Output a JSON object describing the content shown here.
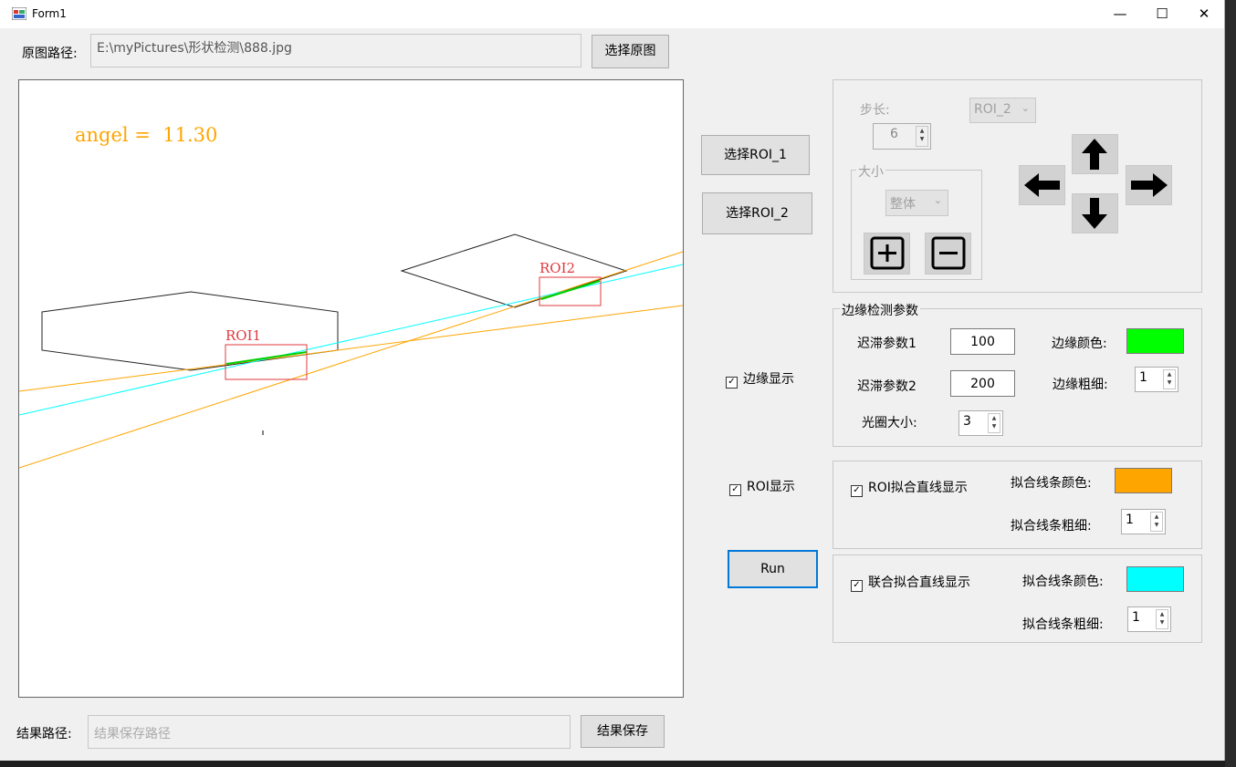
{
  "window": {
    "title": "Form1",
    "minimize": "—",
    "maximize": "☐",
    "close": "✕"
  },
  "top": {
    "path_label": "原图路径:",
    "path_value": "E:\\myPictures\\形状检测\\888.jpg",
    "select_button": "选择原图"
  },
  "canvas": {
    "angle_label": "angel =  11.30",
    "roi1_label": "ROI1",
    "roi2_label": "ROI2"
  },
  "middle": {
    "roi1_button": "选择ROI_1",
    "roi2_button": "选择ROI_2",
    "edge_show": "边缘显示",
    "roi_show": "ROI显示",
    "run_button": "Run"
  },
  "roi_panel": {
    "step_label": "步长:",
    "step_value": "6",
    "roi_select": "ROI_2",
    "size_group": "大小",
    "size_select": "整体",
    "plus_icon": "+",
    "minus_icon": "−"
  },
  "edge_params": {
    "title": "边缘检测参数",
    "hyst1_label": "迟滞参数1",
    "hyst1_value": "100",
    "hyst2_label": "迟滞参数2",
    "hyst2_value": "200",
    "aperture_label": "光圈大小:",
    "aperture_value": "3",
    "edge_color_label": "边缘颜色:",
    "edge_color": "#00ff00",
    "edge_width_label": "边缘粗细:",
    "edge_width_value": "1"
  },
  "roi_fit": {
    "checkbox": "ROI拟合直线显示",
    "color_label": "拟合线条颜色:",
    "color": "#ffa500",
    "width_label": "拟合线条粗细:",
    "width_value": "1"
  },
  "joint_fit": {
    "checkbox": "联合拟合直线显示",
    "color_label": "拟合线条颜色:",
    "color": "#00ffff",
    "width_label": "拟合线条粗细:",
    "width_value": "1"
  },
  "bottom": {
    "result_label": "结果路径:",
    "result_placeholder": "结果保存路径",
    "save_button": "结果保存"
  }
}
